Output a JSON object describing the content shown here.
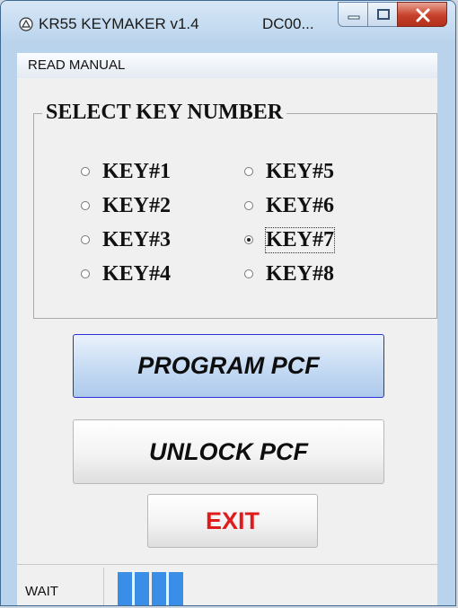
{
  "window": {
    "title": "KR55 KEYMAKER v1.4",
    "subtitle": "DC00...",
    "controls": {
      "minimize_icon": "minimize-icon",
      "maximize_icon": "maximize-icon",
      "close_icon": "close-icon"
    }
  },
  "menu": {
    "items": [
      {
        "label": "READ MANUAL"
      }
    ]
  },
  "key_group": {
    "label": "SELECT KEY NUMBER",
    "options": [
      {
        "label": "KEY#1",
        "checked": false
      },
      {
        "label": "KEY#2",
        "checked": false
      },
      {
        "label": "KEY#3",
        "checked": false
      },
      {
        "label": "KEY#4",
        "checked": false
      },
      {
        "label": "KEY#5",
        "checked": false
      },
      {
        "label": "KEY#6",
        "checked": false
      },
      {
        "label": "KEY#7",
        "checked": true
      },
      {
        "label": "KEY#8",
        "checked": false
      }
    ],
    "selected": "KEY#7"
  },
  "buttons": {
    "program": "PROGRAM PCF",
    "unlock": "UNLOCK PCF",
    "exit": "EXIT"
  },
  "status": {
    "text": "WAIT",
    "progress_segments_filled": 4
  },
  "colors": {
    "exit_text": "#e01b1b",
    "progress_fill": "#3a8ee6",
    "program_border": "#2b2fd8"
  }
}
